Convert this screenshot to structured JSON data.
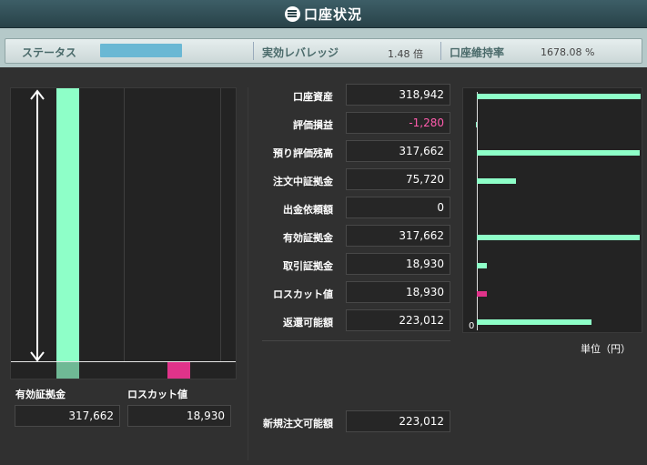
{
  "title": "口座状況",
  "status": {
    "label": "ステータス",
    "leverage_label": "実効レバレッジ",
    "leverage_value": "1.48 倍",
    "margin_ratio_label": "口座維持率",
    "margin_ratio_value": "1678.08 %"
  },
  "rows": [
    {
      "label": "口座資産",
      "value": "318,942"
    },
    {
      "label": "評価損益",
      "value": "-1,280"
    },
    {
      "label": "預り評価残高",
      "value": "317,662"
    },
    {
      "label": "注文中証拠金",
      "value": "75,720"
    },
    {
      "label": "出金依頼額",
      "value": "0"
    },
    {
      "label": "有効証拠金",
      "value": "317,662"
    },
    {
      "label": "取引証拠金",
      "value": "18,930"
    },
    {
      "label": "ロスカット値",
      "value": "18,930"
    },
    {
      "label": "返還可能額",
      "value": "223,012"
    }
  ],
  "new_order": {
    "label": "新規注文可能額",
    "value": "223,012"
  },
  "left_chart": {
    "effective_margin_label": "有効証拠金",
    "effective_margin_value": "317,662",
    "losscut_label": "ロスカット値",
    "losscut_value": "18,930"
  },
  "chart_data": {
    "type": "bar",
    "orientation": "horizontal",
    "categories": [
      "口座資産",
      "評価損益",
      "預り評価残高",
      "注文中証拠金",
      "出金依頼額",
      "有効証拠金",
      "取引証拠金",
      "ロスカット値",
      "返還可能額"
    ],
    "values": [
      318942,
      -1280,
      317662,
      75720,
      0,
      317662,
      18930,
      18930,
      223012
    ],
    "colors": [
      "#8effc8",
      "#8effc8",
      "#8effc8",
      "#8effc8",
      "#8effc8",
      "#8effc8",
      "#8effc8",
      "#e0338a",
      "#8effc8"
    ],
    "axis_zero_label": "0",
    "unit": "単位（円）"
  },
  "colors": {
    "accent": "#8effc8",
    "losscut": "#e0338a",
    "negative": "#ff5cad"
  }
}
